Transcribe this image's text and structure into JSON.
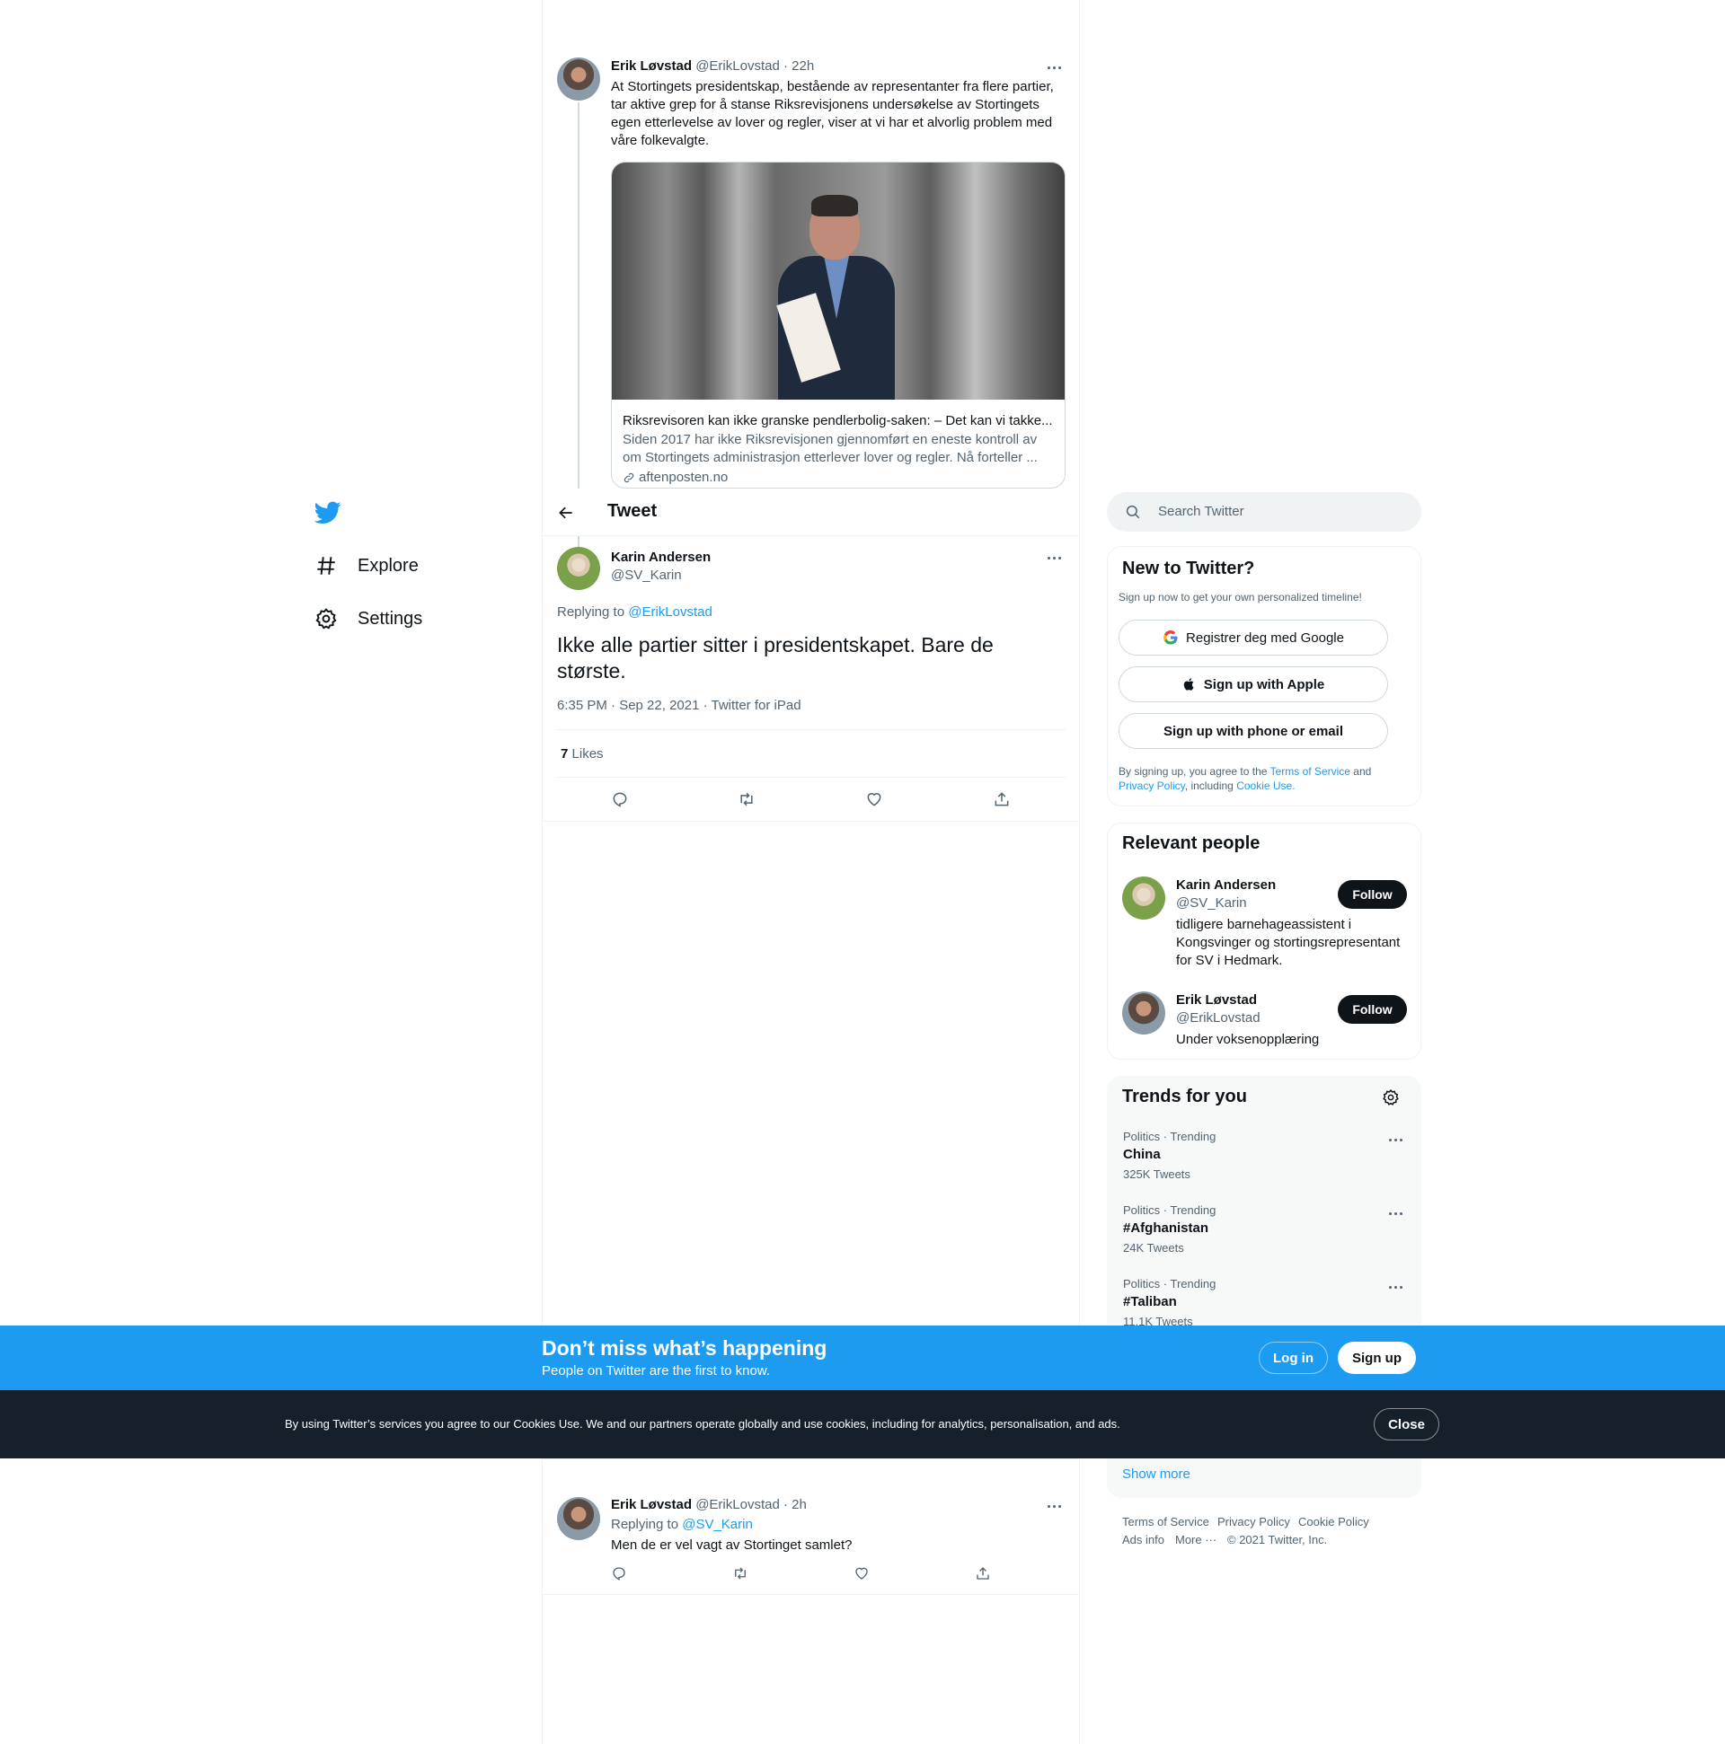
{
  "nav": {
    "explore_label": "Explore",
    "settings_label": "Settings"
  },
  "header": {
    "title": "Tweet"
  },
  "parent_tweet": {
    "name": "Erik Løvstad",
    "handle": "@ErikLovstad",
    "time": "· 22h",
    "text": "At Stortingets presidentskap, bestående av representanter fra flere partier, tar aktive grep for å stanse Riksrevisjonens undersøkelse av Stortingets egen etterlevelse av lover og regler, viser at vi har et alvorlig problem med våre folkevalgte.",
    "card": {
      "title": "Riksrevisoren kan ikke granske pendlerbolig-saken: – Det kan vi takke...",
      "description": "Siden 2017 har ikke Riksrevisjonen gjennomført en eneste kontroll av om Stortingets administrasjon etterlever lover og regler. Nå forteller ...",
      "domain": "aftenposten.no"
    }
  },
  "main_tweet": {
    "name": "Karin Andersen",
    "handle": "@SV_Karin",
    "replying_prefix": "Replying to",
    "replying_to": "@ErikLovstad",
    "text": "Ikke alle partier sitter i presidentskapet. Bare de største.",
    "meta": "6:35 PM · Sep 22, 2021 · Twitter for iPad",
    "likes_count": "7",
    "likes_label": "Likes"
  },
  "reply_tweet": {
    "name": "Erik Løvstad",
    "handle": "@ErikLovstad",
    "time": "· 2h",
    "replying_prefix": "Replying to",
    "replying_to": "@SV_Karin",
    "text": "Men de er vel vagt av Stortinget samlet?"
  },
  "search": {
    "placeholder": "Search Twitter"
  },
  "new_to_twitter": {
    "title": "New to Twitter?",
    "subtitle": "Sign up now to get your own personalized timeline!",
    "google_label": "Registrer deg med Google",
    "apple_label": "Sign up with Apple",
    "phone_label": "Sign up with phone or email",
    "legal_prefix": "By signing up, you agree to the",
    "terms": "Terms of Service",
    "and": "and",
    "privacy": "Privacy Policy",
    "including": ", including",
    "cookie": "Cookie Use."
  },
  "relevant_people": {
    "title": "Relevant people",
    "people": [
      {
        "name": "Karin Andersen",
        "handle": "@SV_Karin",
        "bio": "tidligere barnehageassistent i Kongsvinger og stortingsrepresentant for SV i Hedmark.",
        "follow": "Follow"
      },
      {
        "name": "Erik Løvstad",
        "handle": "@ErikLovstad",
        "bio": "Under voksenopplæring",
        "follow": "Follow"
      }
    ]
  },
  "trends": {
    "title": "Trends for you",
    "items": [
      {
        "meta": "Politics · Trending",
        "name": "China",
        "count": "325K Tweets"
      },
      {
        "meta": "Politics · Trending",
        "name": "#Afghanistan",
        "count": "24K Tweets"
      },
      {
        "meta": "Politics · Trending",
        "name": "#Taliban",
        "count": "11.1K Tweets"
      }
    ],
    "show_more": "Show more"
  },
  "footer": {
    "terms": "Terms of Service",
    "privacy": "Privacy Policy",
    "cookie": "Cookie Policy",
    "ads": "Ads info",
    "more": "More ···",
    "copyright": "© 2021 Twitter, Inc."
  },
  "banner": {
    "title": "Don’t miss what’s happening",
    "subtitle": "People on Twitter are the first to know.",
    "login": "Log in",
    "signup": "Sign up"
  },
  "cookie_bar": {
    "text": "By using Twitter’s services you agree to our Cookies Use. We and our partners operate globally and use cookies, including for analytics, personalisation, and ads.",
    "close": "Close"
  },
  "colors": {
    "brand": "#1d9bf0",
    "text": "#0f1419",
    "muted": "#536471",
    "dark_bar": "#15202b"
  }
}
